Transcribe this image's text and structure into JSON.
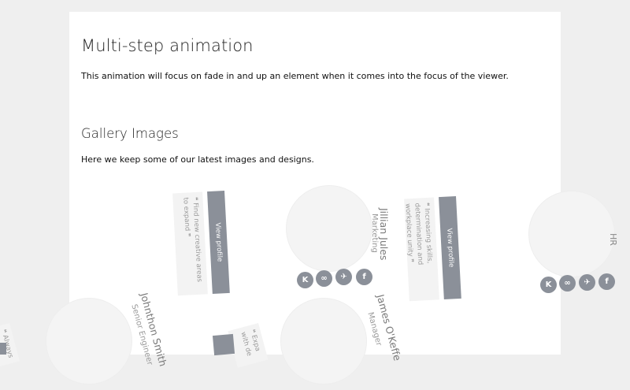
{
  "section1": {
    "title": "Multi-step animation",
    "description": "This animation will focus on fade in and up an element when it comes into the focus of the viewer."
  },
  "section2": {
    "title": "Gallery Images",
    "description": "Here we keep some of our latest images and designs."
  },
  "cards": [
    {
      "name": "Jillian Jules",
      "role": "Marketing",
      "quote": "Find new creative areas to expand",
      "view_label": "View profile"
    },
    {
      "name": "",
      "role": "",
      "quote": "Increasing skills, determination and workplace unity",
      "view_label": "View profile"
    },
    {
      "name": "Johnthon Smith",
      "role": "Senior Engineer",
      "quote": "Always new to",
      "view_label": ""
    },
    {
      "name": "James O'Keffe",
      "role": "Manager",
      "quote": "Expa with de",
      "view_label": ""
    }
  ],
  "social": {
    "icons": [
      "k",
      "link",
      "bird",
      "f"
    ],
    "k": "K",
    "link": "∞",
    "bird": "✈",
    "f": "f"
  },
  "edge_label": "HR",
  "quote_mark": "❝",
  "quote_mark_close": "❞"
}
